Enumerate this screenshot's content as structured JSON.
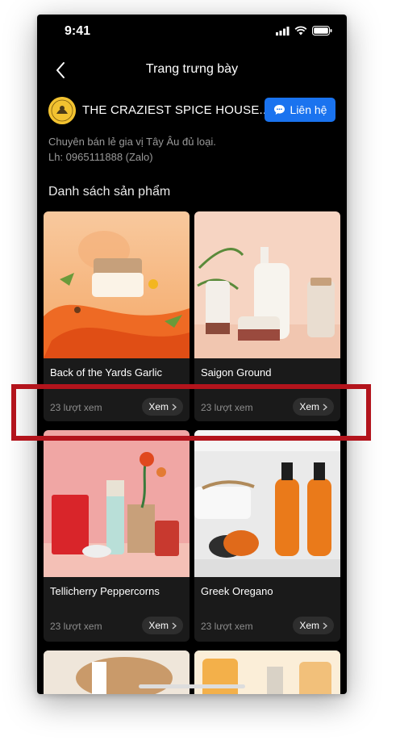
{
  "status": {
    "time": "9:41"
  },
  "nav": {
    "title": "Trang trưng bày"
  },
  "shop": {
    "name": "THE CRAZIEST SPICE HOUSE...",
    "contact_label": "Liên hệ",
    "description_line1": "Chuyên bán lẻ gia vị Tây Âu đủ loại.",
    "description_line2": "Lh: 0965111888 (Zalo)"
  },
  "section": {
    "title": "Danh sách sản phẩm"
  },
  "products": [
    {
      "name": "Back of the Yards Garlic",
      "views": "23 lượt xem",
      "button": "Xem"
    },
    {
      "name": "Saigon Ground",
      "views": "23 lượt xem",
      "button": "Xem"
    },
    {
      "name": "Tellicherry Peppercorns",
      "views": "23 lượt xem",
      "button": "Xem"
    },
    {
      "name": "Greek Oregano",
      "views": "23 lượt xem",
      "button": "Xem"
    }
  ],
  "colors": {
    "accent": "#1a73ef",
    "highlight": "#b3141c",
    "background": "#000000"
  }
}
